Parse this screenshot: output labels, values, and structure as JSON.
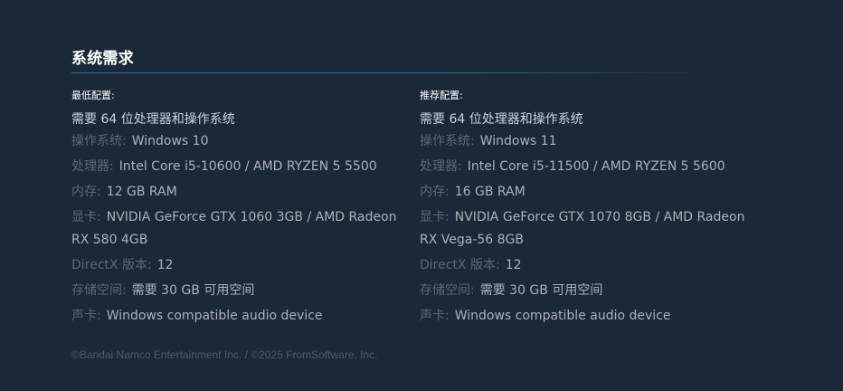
{
  "section": {
    "title": "系统需求"
  },
  "minimum": {
    "header": "最低配置:",
    "note": "需要 64 位处理器和操作系统",
    "rows": [
      {
        "label": "操作系统:",
        "value": "Windows 10"
      },
      {
        "label": "处理器:",
        "value": "Intel Core i5-10600 / AMD RYZEN 5 5500"
      },
      {
        "label": "内存:",
        "value": "12 GB RAM"
      },
      {
        "label": "显卡:",
        "value": "NVIDIA GeForce GTX 1060 3GB / AMD Radeon RX 580 4GB"
      },
      {
        "label": "DirectX 版本:",
        "value": "12"
      },
      {
        "label": "存储空间:",
        "value": "需要 30 GB 可用空间"
      },
      {
        "label": "声卡:",
        "value": "Windows compatible audio device"
      }
    ]
  },
  "recommended": {
    "header": "推荐配置:",
    "note": "需要 64 位处理器和操作系统",
    "rows": [
      {
        "label": "操作系统:",
        "value": "Windows 11"
      },
      {
        "label": "处理器:",
        "value": "Intel Core i5-11500 / AMD RYZEN 5 5600"
      },
      {
        "label": "内存:",
        "value": "16 GB RAM"
      },
      {
        "label": "显卡:",
        "value": "NVIDIA GeForce GTX 1070 8GB / AMD Radeon RX Vega-56 8GB"
      },
      {
        "label": "DirectX 版本:",
        "value": "12"
      },
      {
        "label": "存储空间:",
        "value": "需要 30 GB 可用空间"
      },
      {
        "label": "声卡:",
        "value": "Windows compatible audio device"
      }
    ]
  },
  "footer": {
    "copyright": "©Bandai Namco Entertainment Inc. / ©2025 FromSoftware, Inc."
  },
  "colors": {
    "background": "#1b2838",
    "title": "#ffffff",
    "divider": "#3b6e8f",
    "label": "#5d6872",
    "value": "#acb2b8",
    "footer": "#4f5b66"
  }
}
